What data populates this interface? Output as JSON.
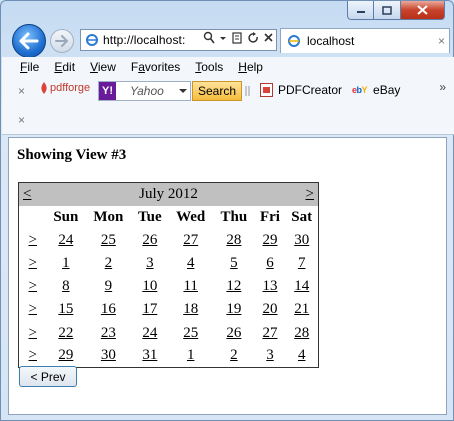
{
  "browser": {
    "address_url": "http://localhost:",
    "tab_label": "localhost",
    "tab_close": "×",
    "menu": [
      "File",
      "Edit",
      "View",
      "Favorites",
      "Tools",
      "Help"
    ],
    "menu_accel": [
      "F",
      "E",
      "V",
      "a",
      "T",
      "H"
    ],
    "toolbar": {
      "close_glyph": "×",
      "pdfforge_label": "pdfforge",
      "yahoo_logo": "Y!",
      "yahoo_placeholder": "Yahoo",
      "search_button": "Search",
      "pdfcreator_label": "PDFCreator",
      "ebay_logo": "ebY",
      "ebay_label": "eBay",
      "more_glyph": "»"
    }
  },
  "page": {
    "heading": "Showing View #3",
    "calendar": {
      "prev_nav": "<",
      "next_nav": ">",
      "month_title": "July 2012",
      "weekdays": [
        "Sun",
        "Mon",
        "Tue",
        "Wed",
        "Thu",
        "Fri",
        "Sat"
      ],
      "week_selector": ">",
      "weeks": [
        [
          "24",
          "25",
          "26",
          "27",
          "28",
          "29",
          "30"
        ],
        [
          "1",
          "2",
          "3",
          "4",
          "5",
          "6",
          "7"
        ],
        [
          "8",
          "9",
          "10",
          "11",
          "12",
          "13",
          "14"
        ],
        [
          "15",
          "16",
          "17",
          "18",
          "19",
          "20",
          "21"
        ],
        [
          "22",
          "23",
          "24",
          "25",
          "26",
          "27",
          "28"
        ],
        [
          "29",
          "30",
          "31",
          "1",
          "2",
          "3",
          "4"
        ]
      ]
    },
    "prev_button": "< Prev"
  }
}
